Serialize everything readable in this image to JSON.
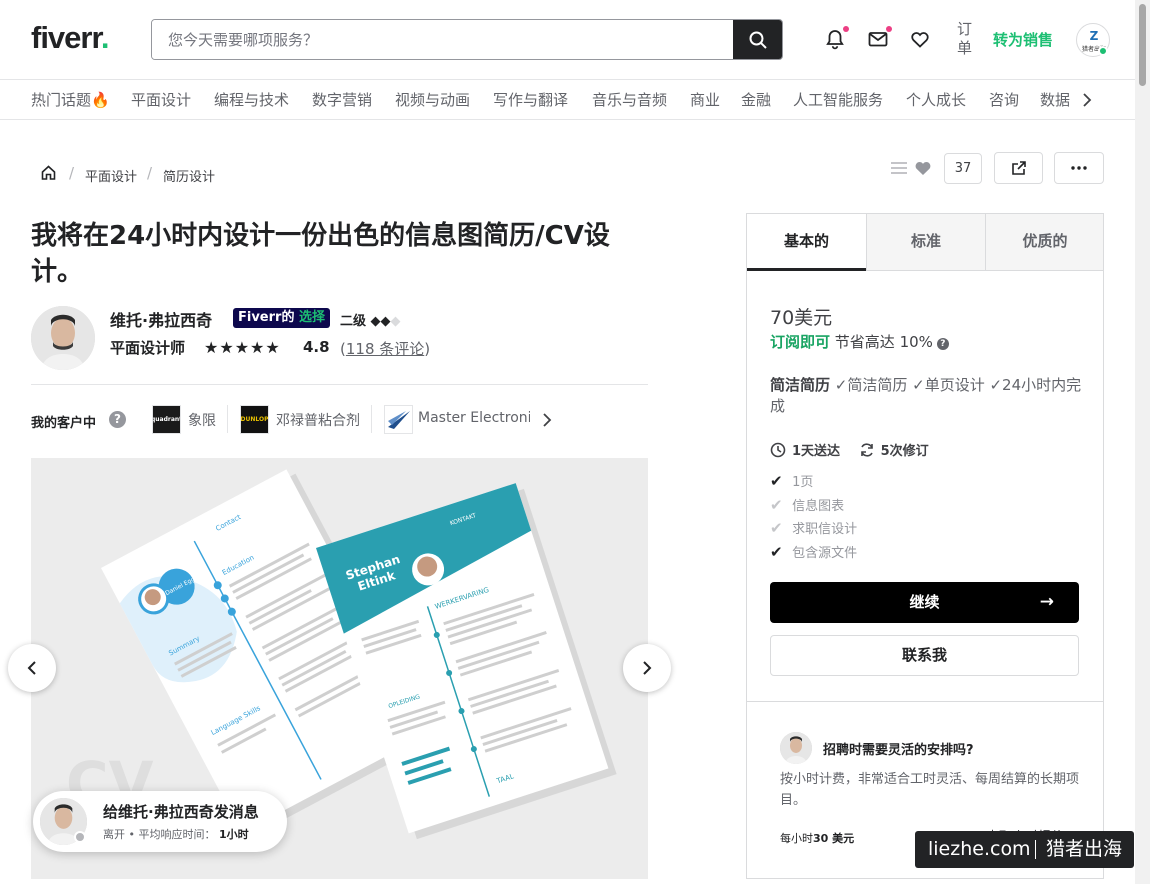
{
  "header": {
    "logo": "fiverr",
    "logo_dot": ".",
    "search_placeholder": "您今天需要哪项服务？",
    "orders_label": "订单",
    "become_seller": "转为销售"
  },
  "categories": [
    "热门话题🔥",
    "平面设计",
    "编程与技术",
    "数字营销",
    "视频与动画",
    "写作与翻译",
    "音乐与音频",
    "商业",
    "金融",
    "人工智能服务",
    "个人成长",
    "咨询",
    "数据"
  ],
  "breadcrumb": {
    "items": [
      "平面设计",
      "简历设计"
    ],
    "separator": "/"
  },
  "toolbar": {
    "save_count": "37"
  },
  "gig": {
    "title": "我将在24小时内设计一份出色的信息图简历/CV设计。",
    "seller_name": "维托·弗拉西奇",
    "choice_badge_a": "Fiverr的",
    "choice_badge_b": "选择",
    "level": "二级",
    "level_diamonds": "◆◆",
    "level_diamond_empty": "◆",
    "role": "平面设计师",
    "stars": "★★★★★",
    "rating": "4.8",
    "reviews_open": "(",
    "reviews": "118 条评论",
    "reviews_close": ")"
  },
  "clients": {
    "label": "我的客户中",
    "help": "?",
    "items": [
      {
        "name": "象限",
        "logo_text": "quadrant",
        "logo_color": "#1a1a1a"
      },
      {
        "name": "邓禄普粘合剂",
        "logo_text": "DUNLOP",
        "logo_color": "#111111"
      },
      {
        "name": "Master Electronic",
        "logo_text": "",
        "logo_color": "#1f4e8c"
      }
    ]
  },
  "gallery": {
    "resume_name_a": "Stephan",
    "resume_name_b": "Eltink",
    "resume_name_c": "Daniel Eggen",
    "resume_head_a": "KONTAKT",
    "resume_head_b": "WERKERVARING",
    "resume_head_c": "Summary",
    "resume_head_d": "Education",
    "resume_head_e": "Language Skills",
    "resume_head_f": "Contact",
    "resume_head_g": "OPLEIDING",
    "resume_head_h": "TAAL",
    "cv_text": "CV"
  },
  "message": {
    "title": "给维托·弗拉西奇发消息",
    "status": "离开",
    "dot": "•",
    "response_label": "平均响应时间：",
    "response_value": "1小时"
  },
  "package": {
    "tabs": [
      "基本的",
      "标准",
      "优质的"
    ],
    "price": "70美元",
    "subscribe": "订阅即可",
    "save_text": "节省高达 10%",
    "q": "?",
    "desc_bold": "简洁简历",
    "desc_rest": " ✓简洁简历 ✓单页设计 ✓24小时内完成",
    "delivery": "1天送达",
    "revisions": "5次修订",
    "features": [
      {
        "label": "1页",
        "included": true
      },
      {
        "label": "信息图表",
        "included": false
      },
      {
        "label": "求职信设计",
        "included": false
      },
      {
        "label": "包含源文件",
        "included": true
      }
    ],
    "continue": "继续",
    "continue_arrow": "→",
    "contact": "联系我"
  },
  "hourly": {
    "title": "招聘时需要灵活的安排吗?",
    "desc": "按小时计费，非常适合工时灵活、每周结算的长期项目。",
    "rate_prefix": "每小时",
    "rate_value": "30 美元",
    "quote": "索取小时报价"
  },
  "watermark": {
    "a": "liezhe.com",
    "b": "猎者出海"
  },
  "colors": {
    "brand_green": "#1dbf73",
    "dark": "#222325",
    "choice_bg": "#0d084d",
    "teal": "#2a9fb0"
  }
}
